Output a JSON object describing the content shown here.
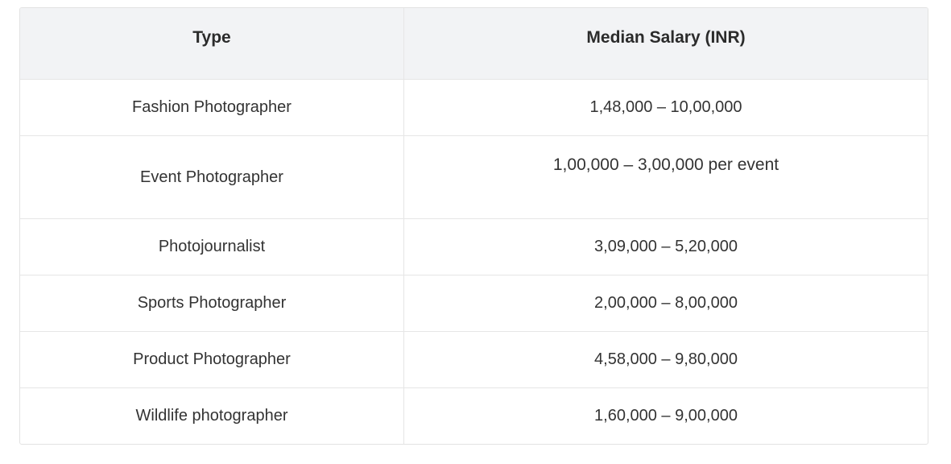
{
  "table": {
    "headers": [
      "Type",
      "Median Salary (INR)"
    ],
    "rows": [
      {
        "type": "Fashion Photographer",
        "salary": "1,48,000 – 10,00,000"
      },
      {
        "type": "Event Photographer",
        "salary": "1,00,000 – 3,00,000 per event"
      },
      {
        "type": "Photojournalist",
        "salary": "3,09,000 – 5,20,000"
      },
      {
        "type": "Sports Photographer",
        "salary": "2,00,000 – 8,00,000"
      },
      {
        "type": "Product Photographer",
        "salary": "4,58,000 – 9,80,000"
      },
      {
        "type": "Wildlife photographer",
        "salary": "1,60,000 – 9,00,000"
      }
    ]
  }
}
